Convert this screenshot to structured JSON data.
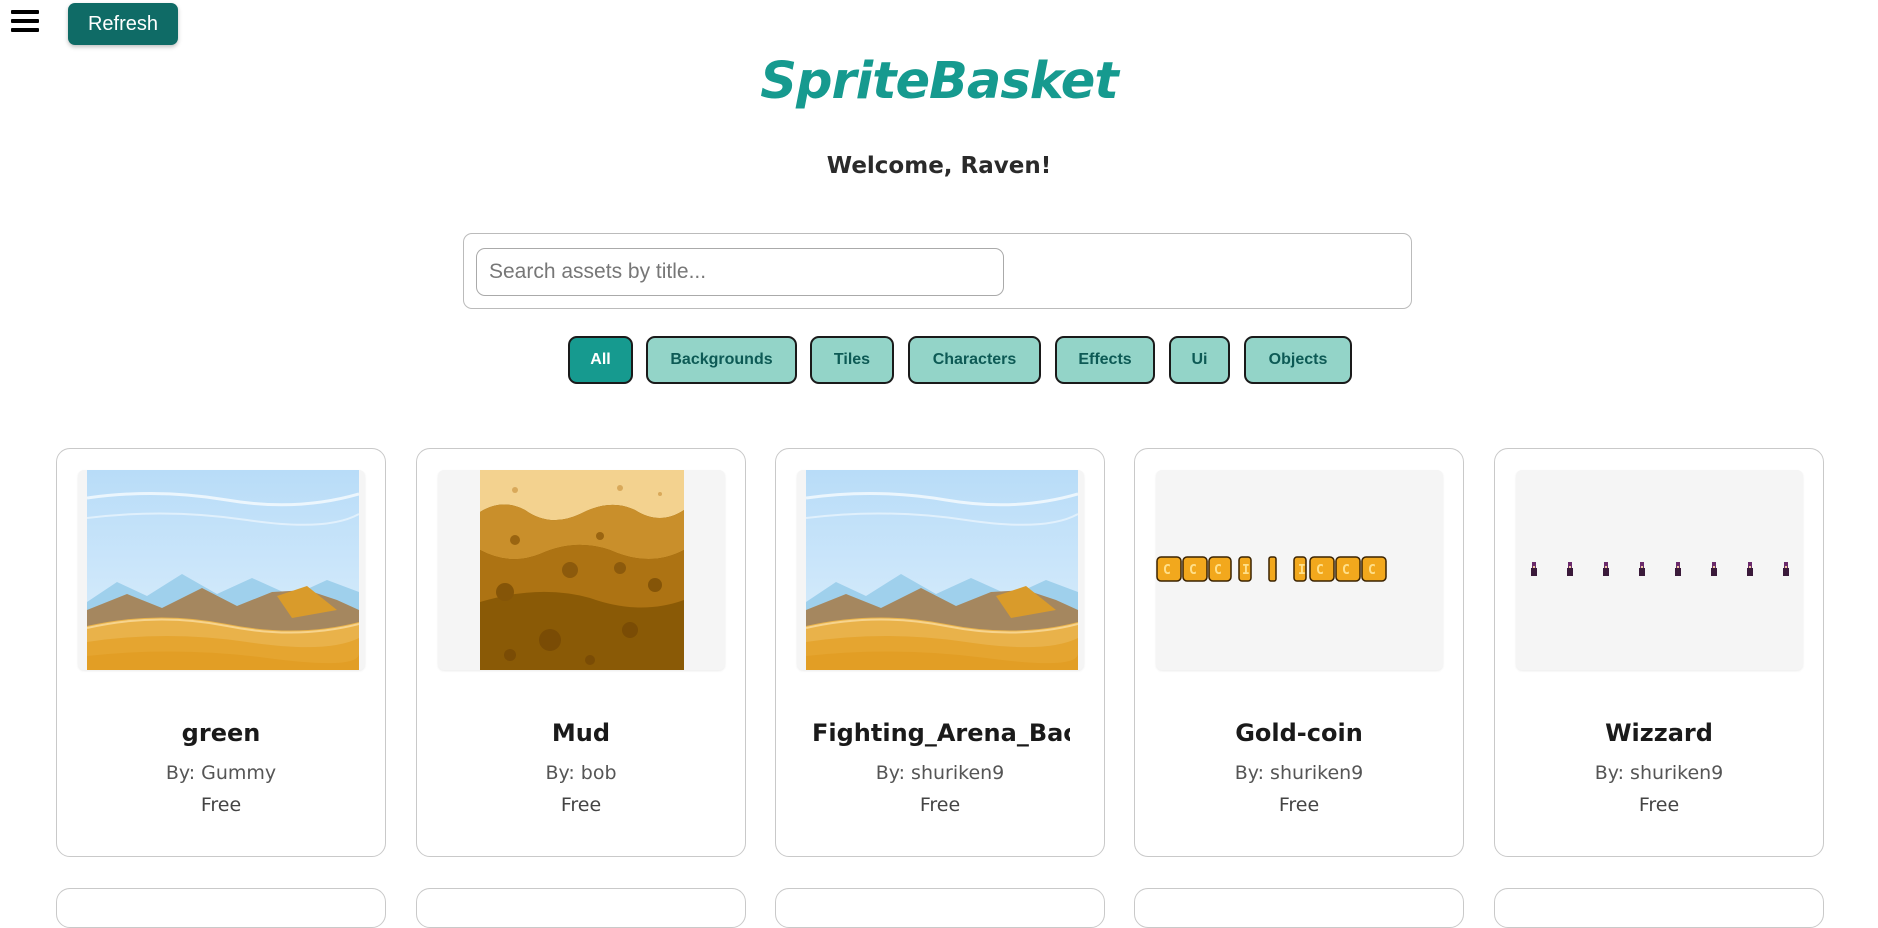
{
  "header": {
    "refresh_label": "Refresh",
    "logo": "SpriteBasket",
    "welcome": "Welcome, Raven!"
  },
  "search": {
    "placeholder": "Search assets by title...",
    "value": ""
  },
  "filters": [
    {
      "label": "All",
      "active": true
    },
    {
      "label": "Backgrounds",
      "active": false
    },
    {
      "label": "Tiles",
      "active": false
    },
    {
      "label": "Characters",
      "active": false
    },
    {
      "label": "Effects",
      "active": false
    },
    {
      "label": "Ui",
      "active": false
    },
    {
      "label": "Objects",
      "active": false
    }
  ],
  "assets": [
    {
      "title": "green",
      "author": "By: Gummy",
      "price": "Free",
      "thumbnail": "desert-background"
    },
    {
      "title": "Mud",
      "author": "By: bob",
      "price": "Free",
      "thumbnail": "mud-tile"
    },
    {
      "title": "Fighting_Arena_Background",
      "author": "By: shuriken9",
      "price": "Free",
      "thumbnail": "desert-background"
    },
    {
      "title": "Gold-coin",
      "author": "By: shuriken9",
      "price": "Free",
      "thumbnail": "gold-coin-spritesheet"
    },
    {
      "title": "Wizzard",
      "author": "By: shuriken9",
      "price": "Free",
      "thumbnail": "wizard-spritesheet"
    }
  ],
  "colors": {
    "brand": "#169a8f",
    "refresh_bg": "#0f6b66",
    "filter_bg": "#93d4c8",
    "filter_text": "#0d5a55"
  }
}
